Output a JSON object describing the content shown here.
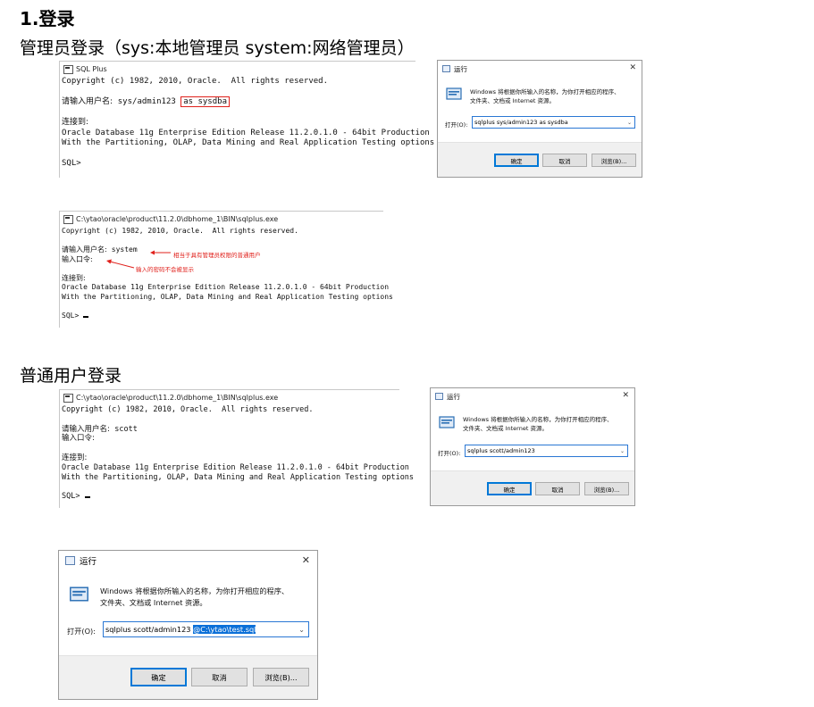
{
  "heading1": "1.登录",
  "heading_admin": "管理员登录（sys:本地管理员   system:网络管理员）",
  "heading_user": "普通用户登录",
  "console1": {
    "title": "SQL Plus",
    "line_copyright": "Copyright (c) 1982, 2010, Oracle.  All rights reserved.",
    "prompt_user": "请输入用户名:  ",
    "user_value": "sys/admin123 ",
    "user_highlight": "as sysdba",
    "connected": "连接到:",
    "edition1": "Oracle Database 11g Enterprise Edition Release 11.2.0.1.0 - 64bit Production",
    "edition2": "With the Partitioning, OLAP, Data Mining and Real Application Testing options",
    "sql_prompt": "SQL>"
  },
  "console2": {
    "title": "C:\\ytao\\oracle\\product\\11.2.0\\dbhome_1\\BIN\\sqlplus.exe",
    "line_copyright": "Copyright (c) 1982, 2010, Oracle.  All rights reserved.",
    "prompt_user": "请输入用户名:  ",
    "user_value": "system",
    "prompt_pass": "输入口令:",
    "connected": "连接到:",
    "edition1": "Oracle Database 11g Enterprise Edition Release 11.2.0.1.0 - 64bit Production",
    "edition2": "With the Partitioning, OLAP, Data Mining and Real Application Testing options",
    "sql_prompt": "SQL> ",
    "annot_user": "相当于具有管理员权限的普通用户",
    "annot_pass": "输入的密码不会被显示"
  },
  "console3": {
    "title": "C:\\ytao\\oracle\\product\\11.2.0\\dbhome_1\\BIN\\sqlplus.exe",
    "line_copyright": "Copyright (c) 1982, 2010, Oracle.  All rights reserved.",
    "prompt_user": "请输入用户名:  ",
    "user_value": "scott",
    "prompt_pass": "输入口令:",
    "connected": "连接到:",
    "edition1": "Oracle Database 11g Enterprise Edition Release 11.2.0.1.0 - 64bit Production",
    "edition2": "With the Partitioning, OLAP, Data Mining and Real Application Testing options",
    "sql_prompt": "SQL> "
  },
  "run_common": {
    "title": "运行",
    "desc_line1": "Windows 将根据你所输入的名称，为你打开相应的程序、",
    "desc_line2": "文件夹、文档或 Internet 资源。",
    "open_label": "打开(O):",
    "ok": "确定",
    "cancel": "取消",
    "browse": "浏览(B)...",
    "close": "✕"
  },
  "run1": {
    "value": "sqlplus sys/admin123 as sysdba"
  },
  "run2": {
    "value": "sqlplus scott/admin123"
  },
  "run3": {
    "value": "sqlplus scott/admin123 ",
    "selected": "@C:\\ytao\\test.sql"
  },
  "icons": {
    "console": "console-icon",
    "run": "run-icon",
    "close": "close-icon",
    "dropdown": "chevron-down-icon"
  },
  "colors": {
    "annotation": "#e0201b",
    "selection": "#0a6fd8",
    "default_button": "#0078d7"
  }
}
